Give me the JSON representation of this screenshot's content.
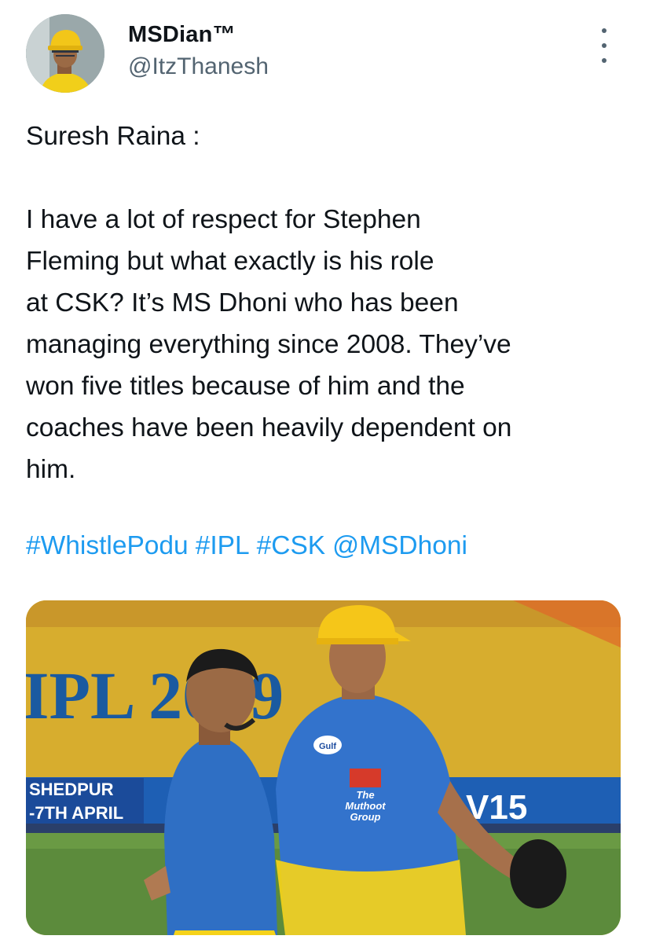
{
  "author": {
    "display_name": "MSDian™",
    "handle": "@ItzThanesh"
  },
  "tweet": {
    "lines_para1": [
      "Suresh Raina :"
    ],
    "lines_para2": [
      "I have a lot of respect for Stephen",
      "Fleming but what exactly is his role",
      "at CSK? It’s MS Dhoni who has been",
      "managing everything since 2008. They’ve",
      "won five titles because of him and the",
      "coaches have been heavily dependent on",
      "him."
    ],
    "hashtags": [
      "#WhistlePodu",
      "#IPL",
      "#CSK",
      "@MSDhoni"
    ]
  },
  "media": {
    "banner_text": "IPL 2019",
    "board_text": [
      "SHEDPUR",
      "-7TH APRIL"
    ],
    "sponsor_text": [
      "Gulf",
      "The",
      "Muthoot",
      "Group"
    ],
    "ad_text": "V15"
  },
  "icons": {
    "menu": "more-vertical-icon"
  },
  "colors": {
    "link": "#1d9bf0",
    "secondary_text": "#536471",
    "jersey_blue": "#2f6fc4",
    "jersey_yellow": "#f5d21a"
  }
}
